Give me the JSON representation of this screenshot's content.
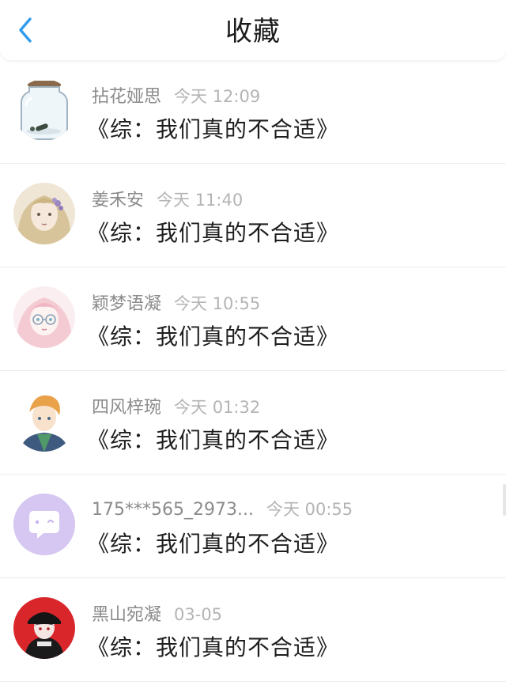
{
  "header": {
    "title": "收藏",
    "back_icon": "chevron-left-icon",
    "accent": "#2f9cf0"
  },
  "items": [
    {
      "username": "拈花娅思",
      "time": "今天 12:09",
      "title": "《综：我们真的不合适》",
      "avatar": "glass-jar"
    },
    {
      "username": "姜禾安",
      "time": "今天 11:40",
      "title": "《综：我们真的不合适》",
      "avatar": "anime-blonde-flowers"
    },
    {
      "username": "颖梦语凝",
      "time": "今天 10:55",
      "title": "《综：我们真的不合适》",
      "avatar": "anime-pink-hair-glasses"
    },
    {
      "username": "四风梓琬",
      "time": "今天 01:32",
      "title": "《综：我们真的不合适》",
      "avatar": "anime-boy-orange-hair"
    },
    {
      "username": "175***565_2973...",
      "time": "今天 00:55",
      "title": "《综：我们真的不合适》",
      "avatar": "default-chat-bubble"
    },
    {
      "username": "黑山宛凝",
      "time": "03-05",
      "title": "《综：我们真的不合适》",
      "avatar": "anime-red-black-cap"
    }
  ]
}
